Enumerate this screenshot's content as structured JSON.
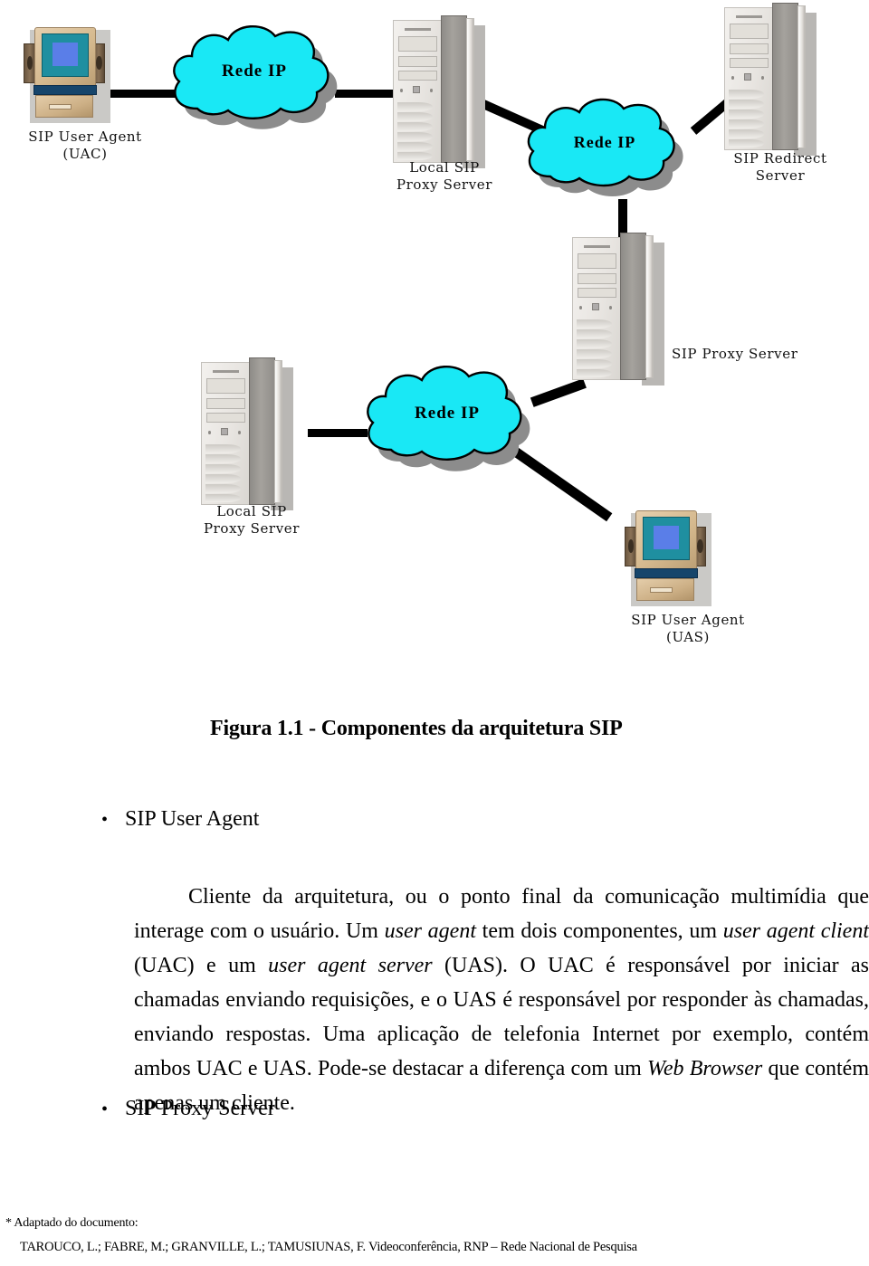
{
  "diagram": {
    "clouds": [
      {
        "label": "Rede IP",
        "name": "cloud-rede-ip-1"
      },
      {
        "label": "Rede IP",
        "name": "cloud-rede-ip-2"
      },
      {
        "label": "Rede IP",
        "name": "cloud-rede-ip-3"
      }
    ],
    "nodes": [
      {
        "label": "SIP User Agent\n(UAC)",
        "type": "desktop-pc"
      },
      {
        "label": "Local SIP\nProxy Server",
        "type": "tower-server"
      },
      {
        "label": "SIP Redirect\nServer",
        "type": "tower-server"
      },
      {
        "label": "SIP Proxy Server",
        "type": "tower-server"
      },
      {
        "label": "Local SIP\nProxy Server",
        "type": "tower-server"
      },
      {
        "label": "SIP User Agent\n(UAS)",
        "type": "desktop-pc"
      }
    ],
    "colors": {
      "cloud_fill": "#19E8F5",
      "cloud_stroke": "#000000",
      "cloud_shadow": "#8C8C8C",
      "link": "#000000"
    }
  },
  "figure": {
    "caption": "Figura 1.1 - Componentes da arquitetura SIP"
  },
  "bullets": [
    {
      "marker": "•",
      "label": "SIP User Agent"
    },
    {
      "marker": "•",
      "label": "SIP Proxy Server"
    }
  ],
  "paragraphs": {
    "sip_user_agent": {
      "p1": "Cliente da arquitetura, ou o ponto final da comunicação multimídia que interage com o usuário. Um ",
      "i1": "user agent",
      "p2": " tem dois componentes, um ",
      "i2": "user agent client",
      "p3": " (UAC) e um ",
      "i3": "user agent server",
      "p4": " (UAS). O UAC é responsável por iniciar as chamadas enviando requisições, e o UAS é responsável por responder às chamadas, enviando respostas. Uma aplicação de telefonia Internet por exemplo, contém ambos UAC e UAS. Pode-se destacar a diferença com um ",
      "i4": "Web Browser",
      "p5": " que contém apenas um cliente."
    }
  },
  "footer": {
    "note": "* Adaptado do documento:",
    "reference": "TAROUCO, L.; FABRE, M.; GRANVILLE, L.; TAMUSIUNAS, F. Videoconferência, RNP – Rede Nacional de Pesquisa"
  }
}
